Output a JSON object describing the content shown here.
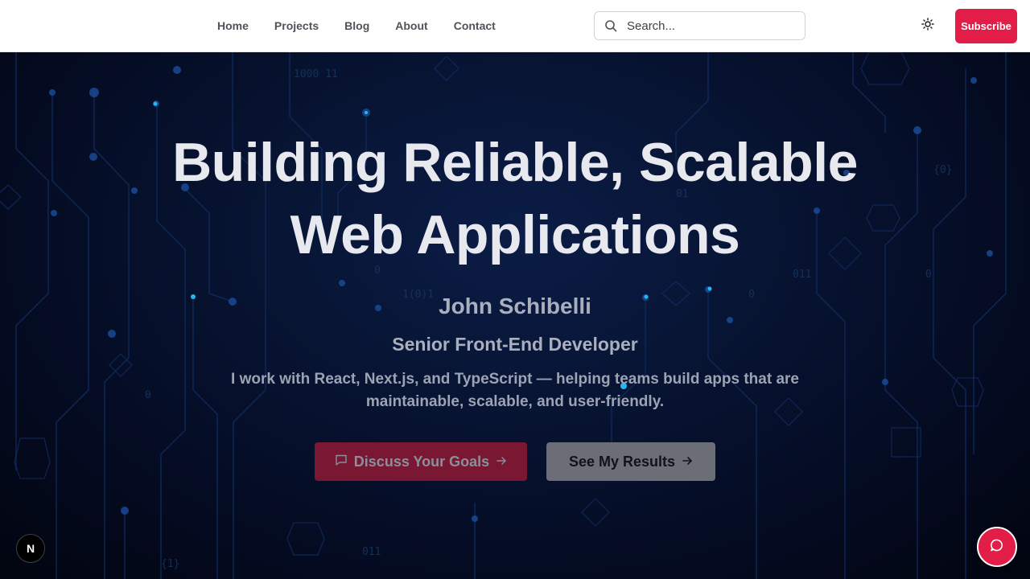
{
  "nav": {
    "items": [
      {
        "label": "Home"
      },
      {
        "label": "Projects"
      },
      {
        "label": "Blog"
      },
      {
        "label": "About"
      },
      {
        "label": "Contact"
      }
    ]
  },
  "search": {
    "placeholder": "Search...",
    "icon": "search-icon"
  },
  "header": {
    "theme_icon": "sun-icon",
    "subscribe_label": "Subscribe"
  },
  "hero": {
    "title_line1": "Building Reliable, Scalable",
    "title_line2": "Web Applications",
    "name": "John Schibelli",
    "role": "Senior Front-End Developer",
    "description": "I work with React, Next.js, and TypeScript — helping teams build apps that are maintainable, scalable, and user-friendly.",
    "primary_cta": "Discuss Your Goals",
    "secondary_cta": "See My Results"
  },
  "floating": {
    "badge_letter": "N",
    "chat_icon": "chat-icon"
  },
  "colors": {
    "accent": "#e11d48",
    "hero_bg": "#071433",
    "title_text": "#e7e9ef"
  }
}
